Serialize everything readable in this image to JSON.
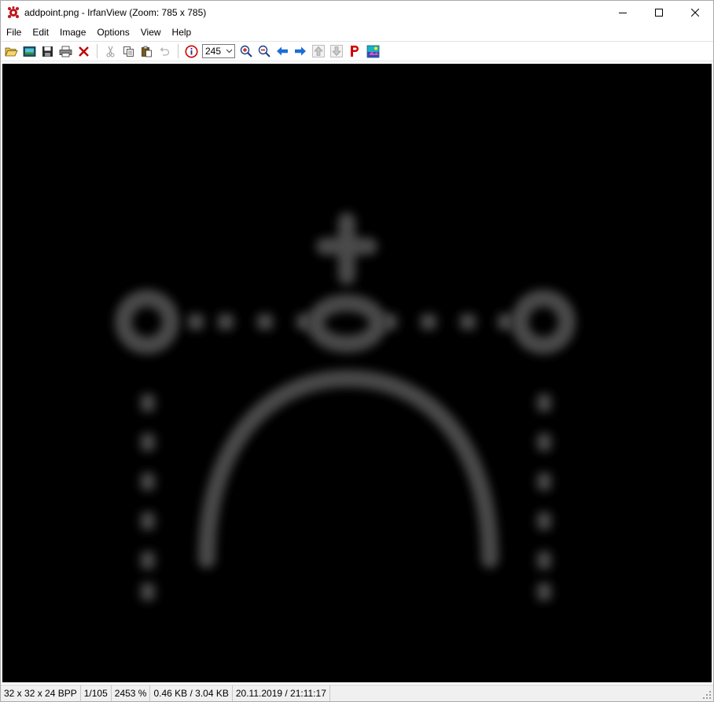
{
  "window": {
    "title": "addpoint.png - IrfanView (Zoom: 785 x 785)",
    "icon": "irfanview-logo-icon",
    "controls": [
      "minimize-icon",
      "maximize-icon",
      "close-icon"
    ]
  },
  "menu": {
    "items": [
      {
        "label": "File"
      },
      {
        "label": "Edit"
      },
      {
        "label": "Image"
      },
      {
        "label": "Options"
      },
      {
        "label": "View"
      },
      {
        "label": "Help"
      }
    ]
  },
  "toolbar": {
    "buttons_left": [
      "open-icon",
      "slideshow-icon",
      "save-icon",
      "print-icon",
      "delete-icon"
    ],
    "buttons_edit": [
      "cut-icon",
      "copy-icon",
      "paste-icon",
      "undo-icon"
    ],
    "zoom_value": "245",
    "buttons_right": [
      "info-icon",
      "zoom-in-icon",
      "zoom-out-icon",
      "previous-icon",
      "next-icon",
      "first-icon",
      "last-icon",
      "paint-icon",
      "thumbnails-icon"
    ]
  },
  "image": {
    "description_icon": "add-point-vector-image",
    "background": "#000000",
    "stroke_color": "#4a4a4a"
  },
  "status": {
    "dimensions": "32 x 32 x 24 BPP",
    "index": "1/105",
    "zoom": "2453 %",
    "filesize": "0.46 KB / 3.04 KB",
    "datetime": "20.11.2019 / 21:11:17"
  },
  "colors": {
    "accent_blue": "#1a6fd6",
    "delete_red": "#c00000",
    "info_red": "#d00000"
  }
}
